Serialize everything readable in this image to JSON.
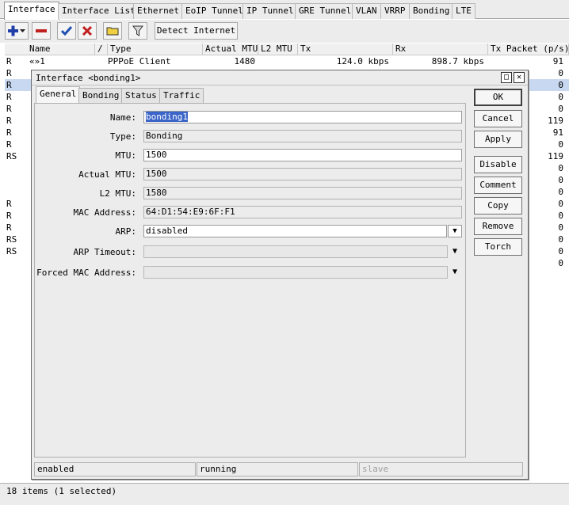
{
  "tabs": [
    "Interface",
    "Interface List",
    "Ethernet",
    "EoIP Tunnel",
    "IP Tunnel",
    "GRE Tunnel",
    "VLAN",
    "VRRP",
    "Bonding",
    "LTE"
  ],
  "toolbar": {
    "detect_label": "Detect Internet"
  },
  "table": {
    "columns": [
      "Name",
      "/",
      "Type",
      "Actual MTU",
      "L2 MTU",
      "Tx",
      "Rx",
      "Tx Packet (p/s)"
    ],
    "first_row": {
      "flag": "R",
      "name": "«»1",
      "type": "PPPoE Client",
      "actual_mtu": "1480",
      "l2_mtu": "",
      "tx": "124.0 kbps",
      "rx": "898.7 kbps",
      "tx_packet": "91"
    },
    "flags": [
      "R",
      "R",
      "R",
      "R",
      "R",
      "R",
      "R",
      "RS",
      "",
      "",
      "",
      "R",
      "R",
      "R",
      "RS",
      "RS",
      ""
    ],
    "tx_packets": [
      "0",
      "0",
      "0",
      "0",
      "119",
      "91",
      "0",
      "119",
      "0",
      "0",
      "0",
      "0",
      "0",
      "0",
      "0",
      "0",
      "0"
    ],
    "selected_index": 1
  },
  "footer": {
    "items_label": "18 items (1 selected)"
  },
  "dialog": {
    "title": "Interface <bonding1>",
    "tabs": [
      "General",
      "Bonding",
      "Status",
      "Traffic"
    ],
    "fields": {
      "name_label": "Name:",
      "name_value": "bonding1",
      "type_label": "Type:",
      "type_value": "Bonding",
      "mtu_label": "MTU:",
      "mtu_value": "1500",
      "actual_mtu_label": "Actual MTU:",
      "actual_mtu_value": "1500",
      "l2_mtu_label": "L2 MTU:",
      "l2_mtu_value": "1580",
      "mac_label": "MAC Address:",
      "mac_value": "64:D1:54:E9:6F:F1",
      "arp_label": "ARP:",
      "arp_value": "disabled",
      "arp_timeout_label": "ARP Timeout:",
      "arp_timeout_value": "",
      "forced_mac_label": "Forced MAC Address:",
      "forced_mac_value": ""
    },
    "buttons": {
      "ok": "OK",
      "cancel": "Cancel",
      "apply": "Apply",
      "disable": "Disable",
      "comment": "Comment",
      "copy": "Copy",
      "remove": "Remove",
      "torch": "Torch"
    },
    "status": {
      "state": "enabled",
      "running": "running",
      "slave": "slave"
    }
  },
  "colors": {
    "selection": "#3a64c8",
    "row_selected": "#c8d8f0",
    "add_icon": "#1f3ea8",
    "remove_icon": "#c02020",
    "check_icon": "#2050b0",
    "cross_icon": "#c02020",
    "folder_icon": "#f0d040"
  }
}
